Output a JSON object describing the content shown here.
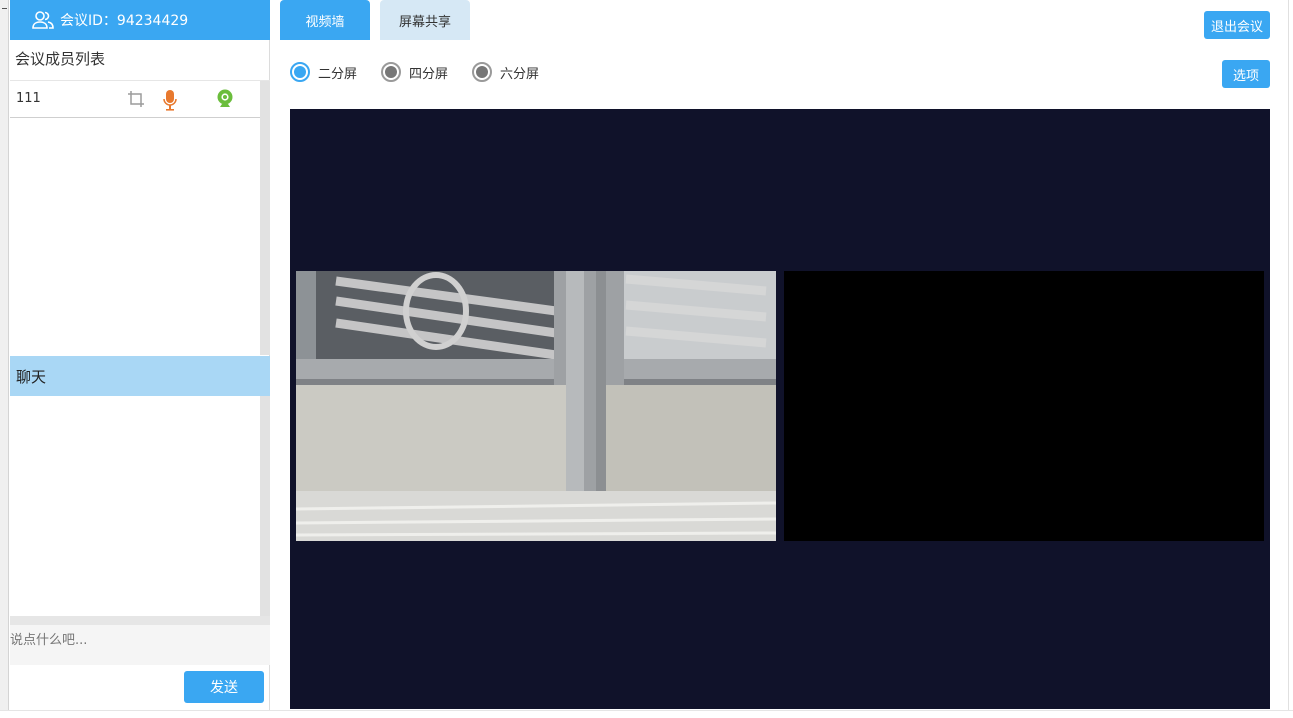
{
  "sidebar": {
    "meeting_id_label": "会议ID：94234429",
    "members_title": "会议成员列表",
    "members": [
      {
        "name": "111",
        "icons": [
          "crop-icon",
          "microphone-icon",
          "webcam-icon"
        ]
      }
    ],
    "chat_title": "聊天",
    "chat_placeholder": "说点什么吧...",
    "send_label": "发送"
  },
  "tabs": [
    {
      "label": "视频墙",
      "active": true
    },
    {
      "label": "屏幕共享",
      "active": false
    }
  ],
  "header": {
    "exit_label": "退出会议",
    "options_label": "选项"
  },
  "layout_options": [
    {
      "label": "二分屏",
      "selected": true
    },
    {
      "label": "四分屏",
      "selected": false
    },
    {
      "label": "六分屏",
      "selected": false
    }
  ],
  "colors": {
    "accent": "#3aa7f2",
    "chat_header": "#a9d7f5",
    "video_wall_bg": "#10122a",
    "mic": "#e8792e",
    "webcam": "#6bbd3c"
  }
}
